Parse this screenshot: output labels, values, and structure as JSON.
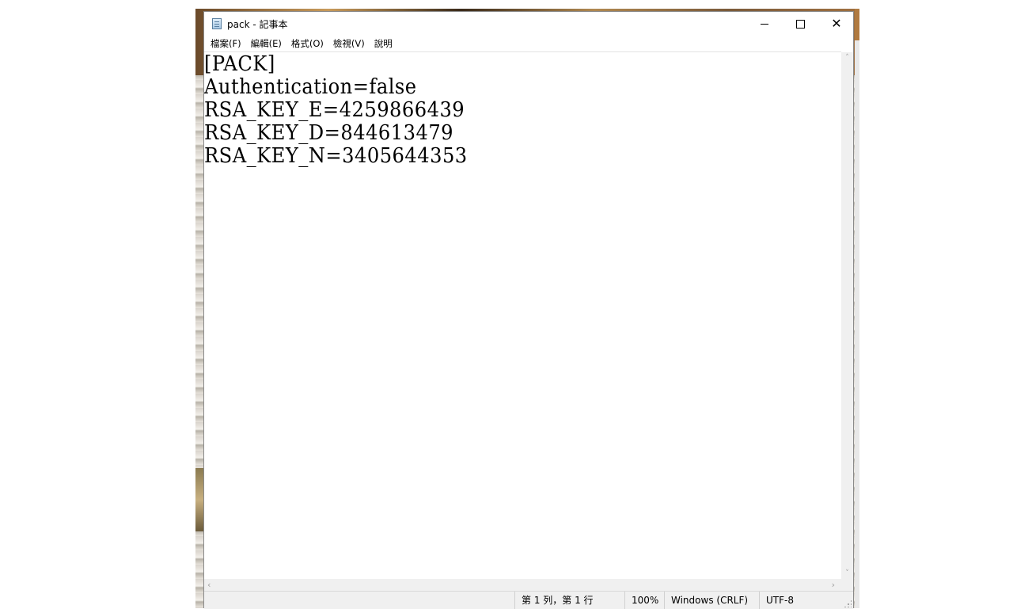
{
  "window": {
    "title": "pack - 記事本",
    "icons": {
      "app": "notepad-icon",
      "minimize": "minimize-icon",
      "maximize": "maximize-icon",
      "close": "close-icon"
    }
  },
  "menu": [
    {
      "label": "檔案(F)"
    },
    {
      "label": "編輯(E)"
    },
    {
      "label": "格式(O)"
    },
    {
      "label": "檢視(V)"
    },
    {
      "label": "說明"
    }
  ],
  "editor": {
    "lines": [
      "[PACK]",
      "Authentication=false",
      "RSA_KEY_E=4259866439",
      "RSA_KEY_D=844613479",
      "RSA_KEY_N=3405644353"
    ]
  },
  "scrollbars": {
    "up_arrow": "˄",
    "down_arrow": "˅",
    "left_arrow": "‹",
    "right_arrow": "›"
  },
  "status": {
    "position": "第 1 列，第 1 行",
    "zoom": "100%",
    "line_ending": "Windows (CRLF)",
    "encoding": "UTF-8"
  }
}
